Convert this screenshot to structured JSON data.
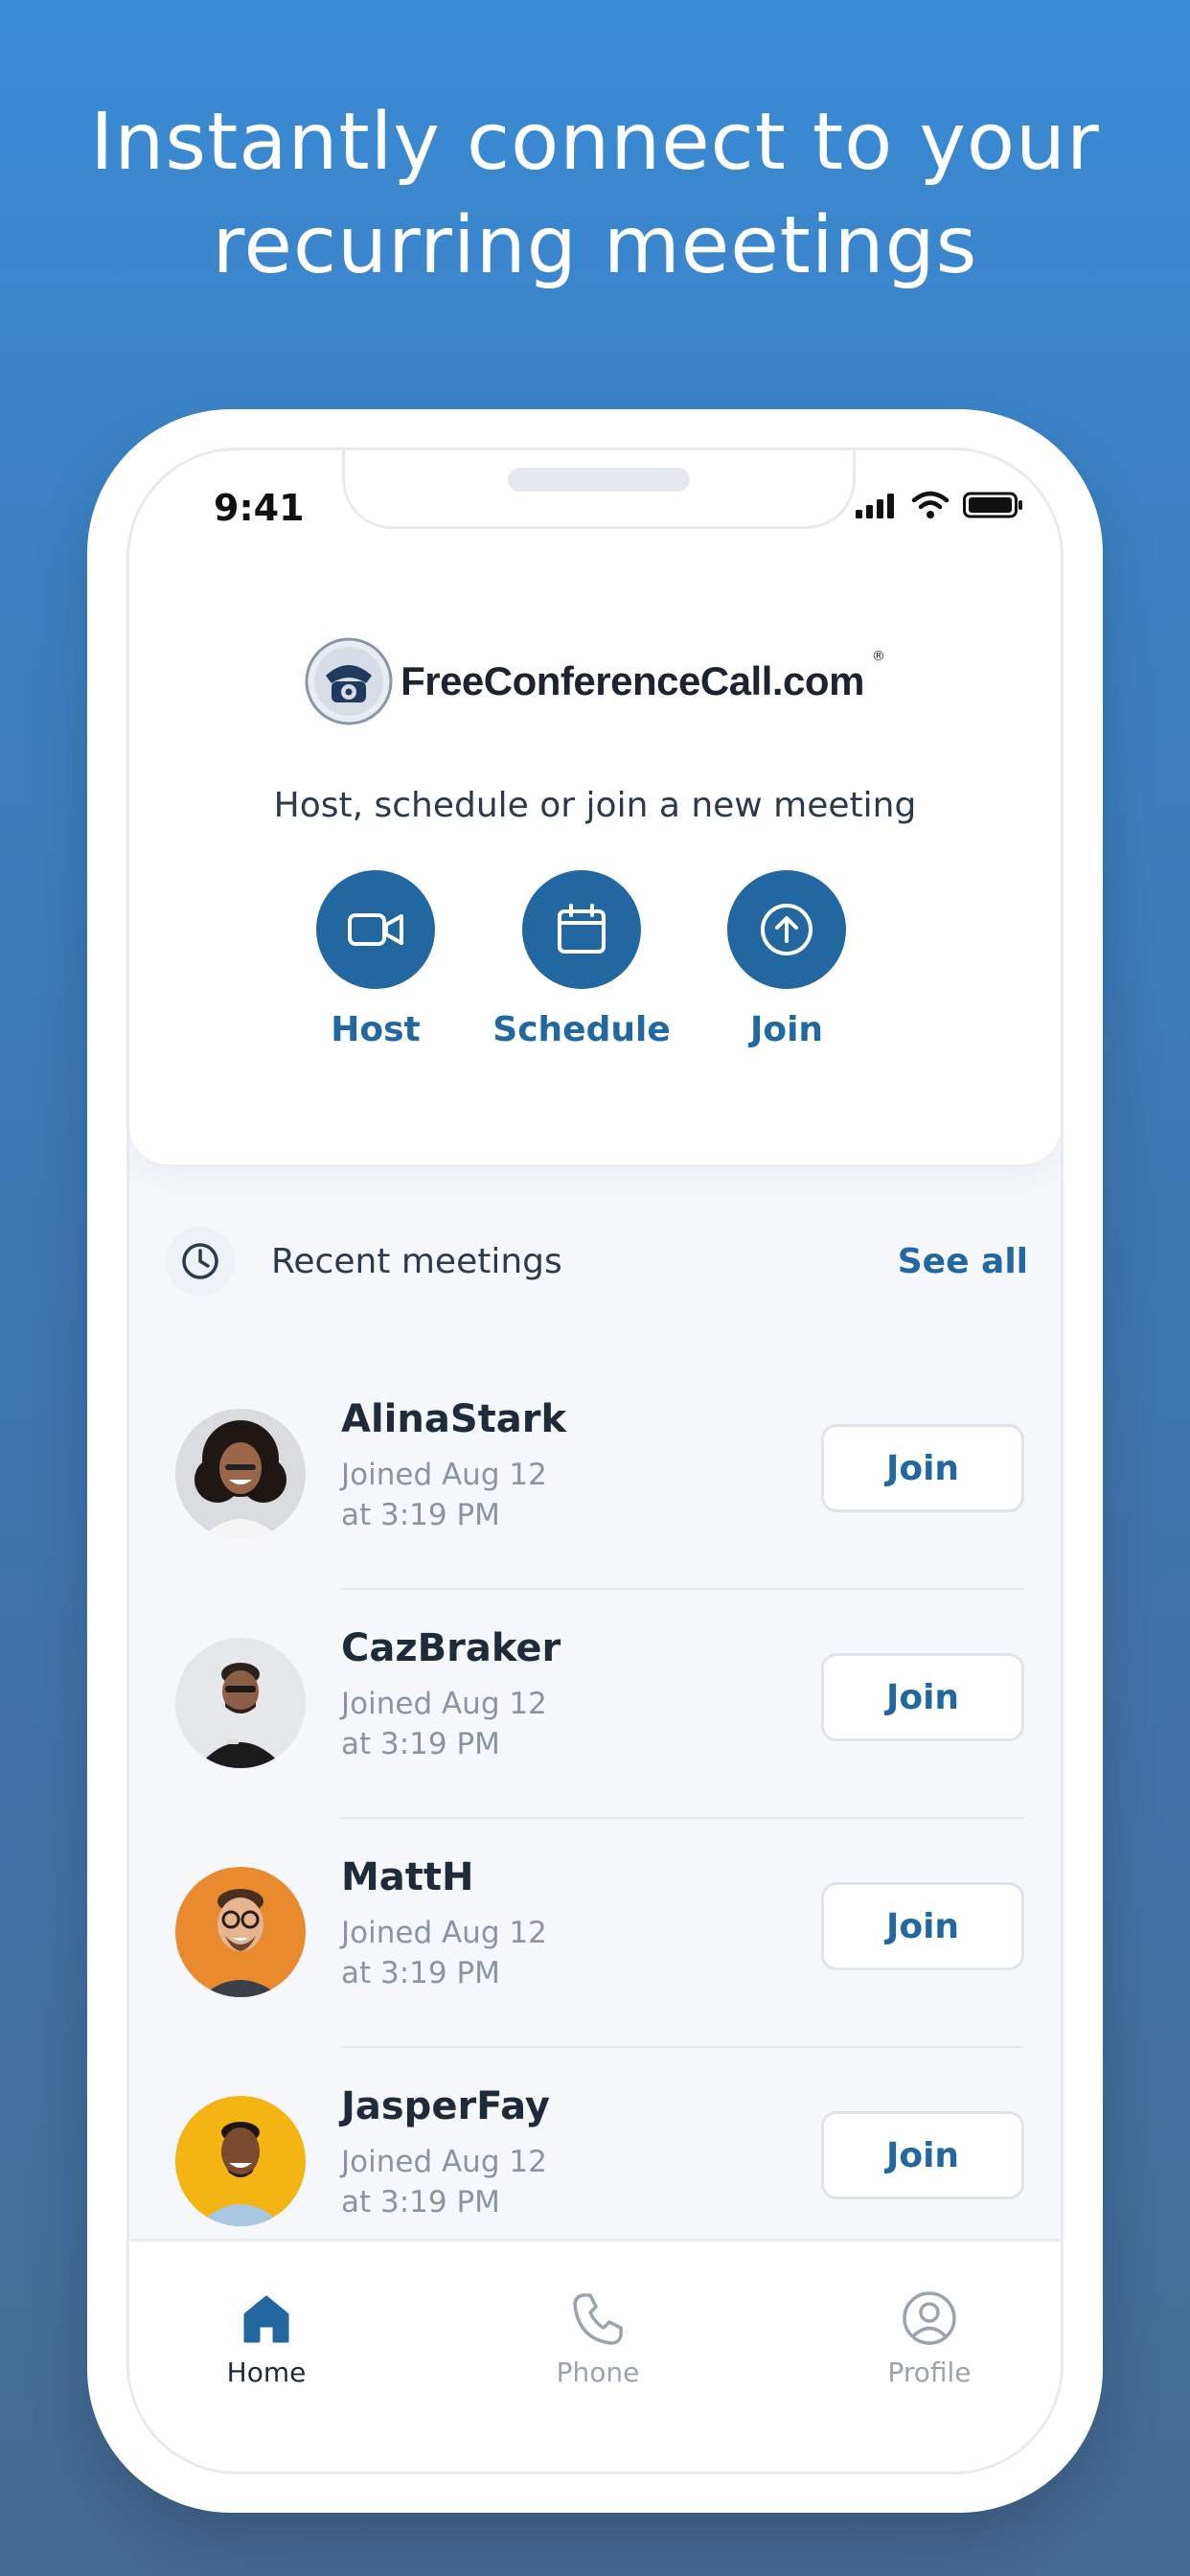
{
  "headline": {
    "line1": "Instantly connect to your",
    "line2": "recurring meetings"
  },
  "status": {
    "time": "9:41"
  },
  "brand": {
    "name": "FreeConferenceCall.com",
    "reg": "®"
  },
  "home": {
    "tagline": "Host, schedule or join a new meeting",
    "actions": [
      {
        "label": "Host",
        "icon": "video-camera-icon"
      },
      {
        "label": "Schedule",
        "icon": "calendar-icon"
      },
      {
        "label": "Join",
        "icon": "arrow-up-circle-icon"
      }
    ]
  },
  "recent": {
    "title": "Recent meetings",
    "see_all": "See all",
    "items": [
      {
        "name": "AlinaStark",
        "line1": "Joined Aug 12",
        "line2": "at 3:19 PM",
        "button": "Join"
      },
      {
        "name": "CazBraker",
        "line1": "Joined Aug 12",
        "line2": "at 3:19 PM",
        "button": "Join"
      },
      {
        "name": "MattH",
        "line1": "Joined Aug 12",
        "line2": "at 3:19 PM",
        "button": "Join"
      },
      {
        "name": "JasperFay",
        "line1": "Joined Aug 12",
        "line2": "at 3:19 PM",
        "button": "Join"
      }
    ]
  },
  "tabs": [
    {
      "label": "Home",
      "icon": "home-icon",
      "active": true
    },
    {
      "label": "Phone",
      "icon": "phone-icon",
      "active": false
    },
    {
      "label": "Profile",
      "icon": "profile-icon",
      "active": false
    }
  ],
  "colors": {
    "accent": "#22679f",
    "background_top": "#3a8ad3",
    "background_bottom": "#456a93"
  }
}
